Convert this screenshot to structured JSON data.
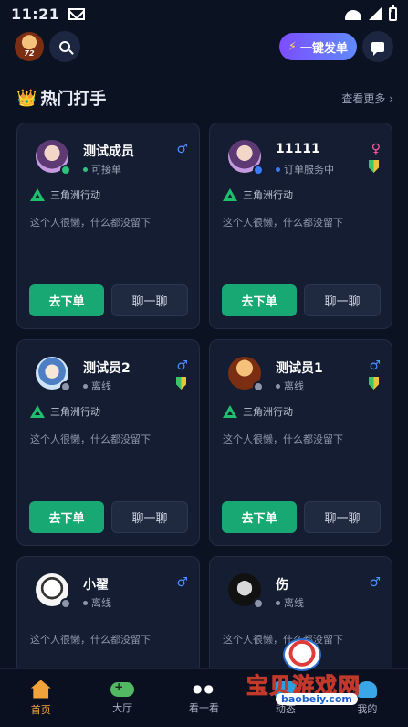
{
  "status_bar": {
    "time": "11:21"
  },
  "topbar": {
    "logo_text": "72",
    "order_button_label": "一键发单"
  },
  "section": {
    "title": "热门打手",
    "more_label": "查看更多 ›"
  },
  "cards": [
    {
      "name": "测试成员",
      "status": "可接单",
      "status_color": "#2fc27a",
      "gender": "♂",
      "gender_color": "#4a90ff",
      "game": "三角洲行动",
      "bio": "这个人很懒，什么都没留下",
      "order_label": "去下单",
      "chat_label": "聊一聊",
      "avatar_style": "purple",
      "dot_color": "#2fc27a",
      "badge": false
    },
    {
      "name": "11111",
      "status": "订单服务中",
      "status_color": "#3a7bff",
      "gender": "♀",
      "gender_color": "#ff5aa5",
      "game": "三角洲行动",
      "bio": "这个人很懒，什么都没留下",
      "order_label": "去下单",
      "chat_label": "聊一聊",
      "avatar_style": "purple",
      "dot_color": "#3a7bff",
      "badge": true
    },
    {
      "name": "测试员2",
      "status": "离线",
      "status_color": "#8c95aa",
      "gender": "♂",
      "gender_color": "#4a90ff",
      "game": "三角洲行动",
      "bio": "这个人很懒，什么都没留下",
      "order_label": "去下单",
      "chat_label": "聊一聊",
      "avatar_style": "blue",
      "dot_color": "#8c95aa",
      "badge": true
    },
    {
      "name": "测试员1",
      "status": "离线",
      "status_color": "#8c95aa",
      "gender": "♂",
      "gender_color": "#4a90ff",
      "game": "三角洲行动",
      "bio": "这个人很懒，什么都没留下",
      "order_label": "去下单",
      "chat_label": "聊一聊",
      "avatar_style": "brown",
      "dot_color": "#8c95aa",
      "badge": true
    },
    {
      "name": "小翟",
      "status": "离线",
      "status_color": "#8c95aa",
      "gender": "♂",
      "gender_color": "#4a90ff",
      "bio": "这个人很懒，什么都没留下",
      "avatar_style": "white",
      "dot_color": "#8c95aa"
    },
    {
      "name": "伤",
      "status": "离线",
      "status_color": "#8c95aa",
      "gender": "♂",
      "gender_color": "#4a90ff",
      "bio": "这个人很懒，什么都没留下",
      "avatar_style": "dark",
      "dot_color": "#8c95aa"
    }
  ],
  "nav": [
    {
      "label": "首页",
      "icon": "home-icon",
      "active": true
    },
    {
      "label": "大厅",
      "icon": "gamepad-icon"
    },
    {
      "label": "看一看",
      "icon": "eyes-icon"
    },
    {
      "label": "动态",
      "icon": "trend-icon"
    },
    {
      "label": "我的",
      "icon": "profile-icon"
    }
  ],
  "watermark": {
    "text": "宝贝游戏网",
    "url": "baobeiy.com"
  },
  "colors": {
    "accent_green": "#17a874",
    "accent_orange": "#f2a33a",
    "background": "#0b1222",
    "card": "#141d31"
  }
}
